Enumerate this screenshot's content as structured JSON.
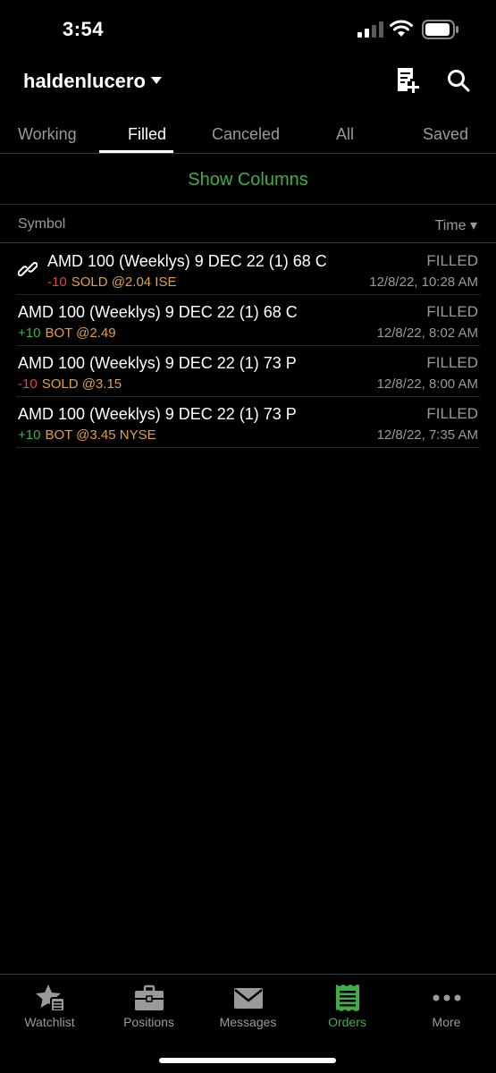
{
  "status": {
    "time": "3:54"
  },
  "header": {
    "account": "haldenlucero"
  },
  "tabs": [
    {
      "label": "Working"
    },
    {
      "label": "Filled"
    },
    {
      "label": "Canceled"
    },
    {
      "label": "All"
    },
    {
      "label": "Saved"
    }
  ],
  "active_tab": "Filled",
  "show_columns": "Show Columns",
  "columns": {
    "symbol": "Symbol",
    "time": "Time ▾"
  },
  "orders": [
    {
      "desc": "AMD 100 (Weeklys) 9 DEC 22 (1) 68 C",
      "qty": "-10",
      "fill": "SOLD @2.04 ISE",
      "status": "FILLED",
      "time": "12/8/22, 10:28 AM",
      "linked": true
    },
    {
      "desc": "AMD 100 (Weeklys) 9 DEC 22 (1) 68 C",
      "qty": "+10",
      "fill": "BOT @2.49",
      "status": "FILLED",
      "time": "12/8/22, 8:02 AM",
      "linked": false
    },
    {
      "desc": "AMD 100 (Weeklys) 9 DEC 22 (1) 73 P",
      "qty": "-10",
      "fill": "SOLD @3.15",
      "status": "FILLED",
      "time": "12/8/22, 8:00 AM",
      "linked": false
    },
    {
      "desc": "AMD 100 (Weeklys) 9 DEC 22 (1) 73 P",
      "qty": "+10",
      "fill": "BOT @3.45 NYSE",
      "status": "FILLED",
      "time": "12/8/22, 7:35 AM",
      "linked": false
    }
  ],
  "bottom_nav": [
    {
      "label": "Watchlist",
      "icon": "watchlist-star-icon"
    },
    {
      "label": "Positions",
      "icon": "briefcase-icon"
    },
    {
      "label": "Messages",
      "icon": "envelope-icon"
    },
    {
      "label": "Orders",
      "icon": "orders-receipt-icon"
    },
    {
      "label": "More",
      "icon": "more-dots-icon"
    }
  ],
  "colors": {
    "accent_green": "#3fae49",
    "sell_red": "#e5433d",
    "fill_orange": "#e0a243",
    "muted": "#9a9a9a"
  }
}
